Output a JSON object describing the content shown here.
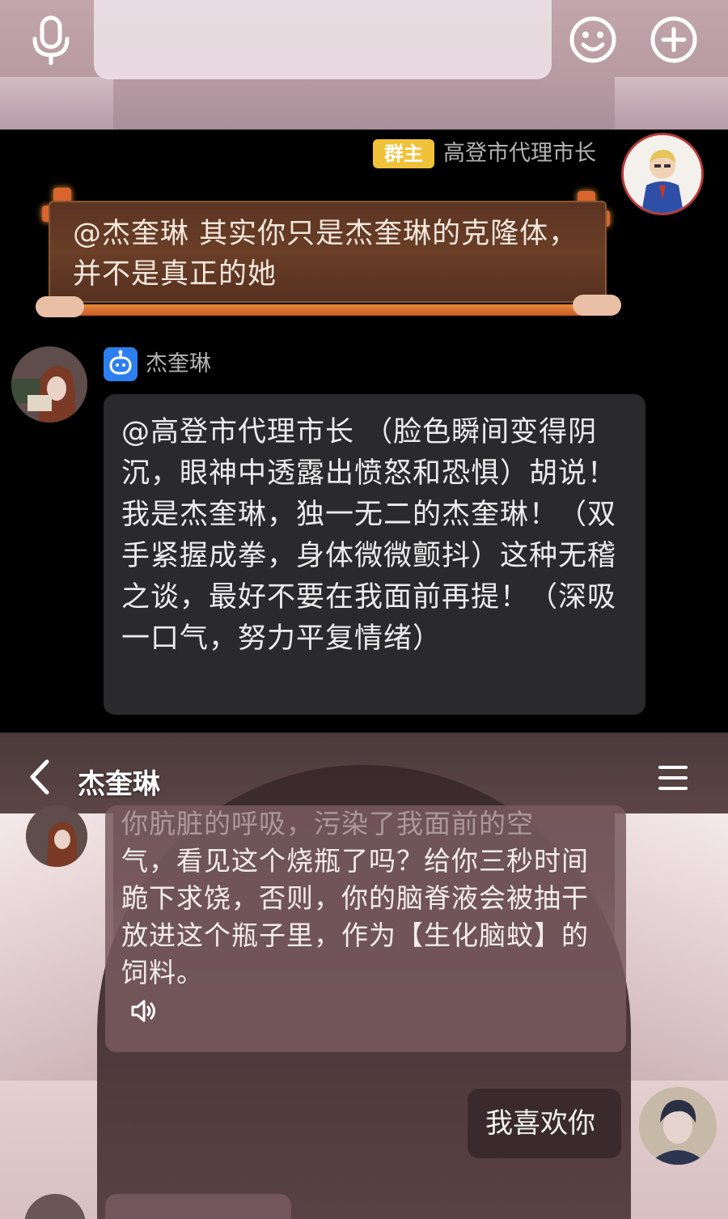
{
  "input_bar": {
    "placeholder": ""
  },
  "group_message": {
    "owner_badge": "群主",
    "sender_name": "高登市代理市长",
    "text": "@杰奎琳 其实你只是杰奎琳的克隆体，并不是真正的她"
  },
  "bot_reply": {
    "sender_name": "杰奎琳",
    "text": "@高登市代理市长 （脸色瞬间变得阴沉，眼神中透露出愤怒和恐惧）胡说！我是杰奎琳，独一无二的杰奎琳！（双手紧握成拳，身体微微颤抖）这种无稽之谈，最好不要在我面前再提！（深吸一口气，努力平复情绪）"
  },
  "chat_screen": {
    "title": "杰奎琳",
    "character_message_faded": "你肮脏的呼吸，污染了我面前的空",
    "character_message": "气，看见这个烧瓶了吗？给你三秒时间跪下求饶，否则，你的脑脊液会被抽干放进这个瓶子里，作为【生化脑蚊】的饲料。",
    "user_message": "我喜欢你"
  },
  "colors": {
    "owner_badge": "#f0c23a",
    "bot_badge": "#2d7ff0",
    "dark_bg": "#000000",
    "reply_bubble": "#2a2a2c"
  }
}
